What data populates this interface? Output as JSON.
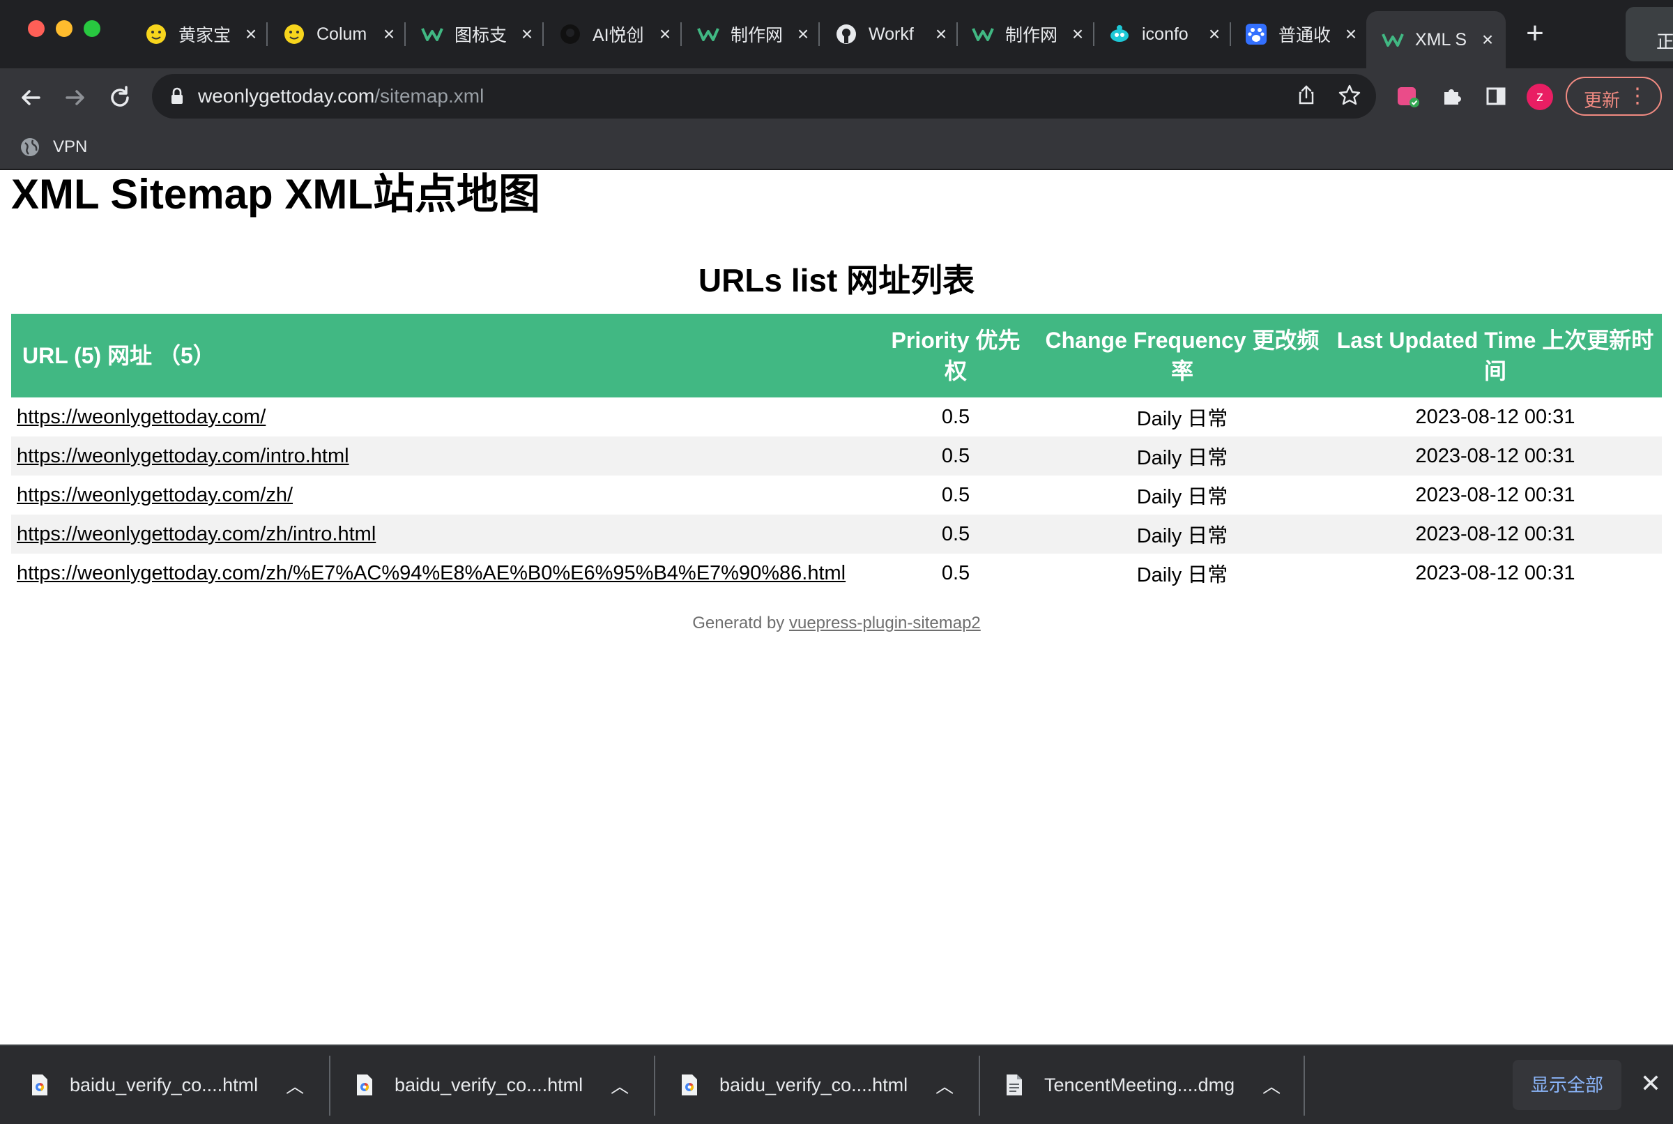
{
  "browser": {
    "tabs": [
      {
        "label": "黄家宝",
        "icon": "smiley-icon",
        "active": false
      },
      {
        "label": "Colum",
        "icon": "smiley-icon",
        "active": false
      },
      {
        "label": "图标支",
        "icon": "w-logo-icon",
        "active": false
      },
      {
        "label": "AI悦创",
        "icon": "github-icon",
        "active": false
      },
      {
        "label": "制作网",
        "icon": "w-logo-icon",
        "active": false
      },
      {
        "label": "Workf",
        "icon": "github-icon",
        "active": false
      },
      {
        "label": "制作网",
        "icon": "w-logo-icon",
        "active": false
      },
      {
        "label": "iconfo",
        "icon": "iconfont-icon",
        "active": false
      },
      {
        "label": "普通收",
        "icon": "baidu-paw-icon",
        "active": false
      },
      {
        "label": "XML S",
        "icon": "w-logo-icon",
        "active": true
      }
    ],
    "profile_corner_label": "正",
    "url_host": "weonlygettoday.com",
    "url_path": "/sitemap.xml",
    "avatar_letter": "z",
    "update_label": "更新",
    "bookmarks": [
      {
        "label": "VPN",
        "icon": "globe-icon"
      }
    ]
  },
  "page": {
    "title": "XML Sitemap XML站点地图",
    "subtitle": "URLs list 网址列表",
    "table": {
      "headers": {
        "url": "URL (5) 网址 （5）",
        "priority": "Priority 优先权",
        "frequency": "Change Frequency 更改频率",
        "updated": "Last Updated Time 上次更新时间"
      },
      "rows": [
        {
          "url": "https://weonlygettoday.com/",
          "priority": "0.5",
          "frequency": "Daily 日常",
          "updated": "2023-08-12 00:31"
        },
        {
          "url": "https://weonlygettoday.com/intro.html",
          "priority": "0.5",
          "frequency": "Daily 日常",
          "updated": "2023-08-12 00:31"
        },
        {
          "url": "https://weonlygettoday.com/zh/",
          "priority": "0.5",
          "frequency": "Daily 日常",
          "updated": "2023-08-12 00:31"
        },
        {
          "url": "https://weonlygettoday.com/zh/intro.html",
          "priority": "0.5",
          "frequency": "Daily 日常",
          "updated": "2023-08-12 00:31"
        },
        {
          "url": "https://weonlygettoday.com/zh/%E7%AC%94%E8%AE%B0%E6%95%B4%E7%90%86.html",
          "priority": "0.5",
          "frequency": "Daily 日常",
          "updated": "2023-08-12 00:31"
        }
      ]
    },
    "footer_prefix": "Generatd by ",
    "footer_link": "vuepress-plugin-sitemap2"
  },
  "downloads": {
    "items": [
      {
        "name": "baidu_verify_co....html"
      },
      {
        "name": "baidu_verify_co....html"
      },
      {
        "name": "baidu_verify_co....html"
      },
      {
        "name": "TencentMeeting....dmg"
      }
    ],
    "show_all_label": "显示全部"
  },
  "colors": {
    "table_header": "#41b883",
    "alt_row": "#f2f2f2",
    "chrome_dark": "#202124",
    "chrome_toolbar": "#35363a"
  }
}
